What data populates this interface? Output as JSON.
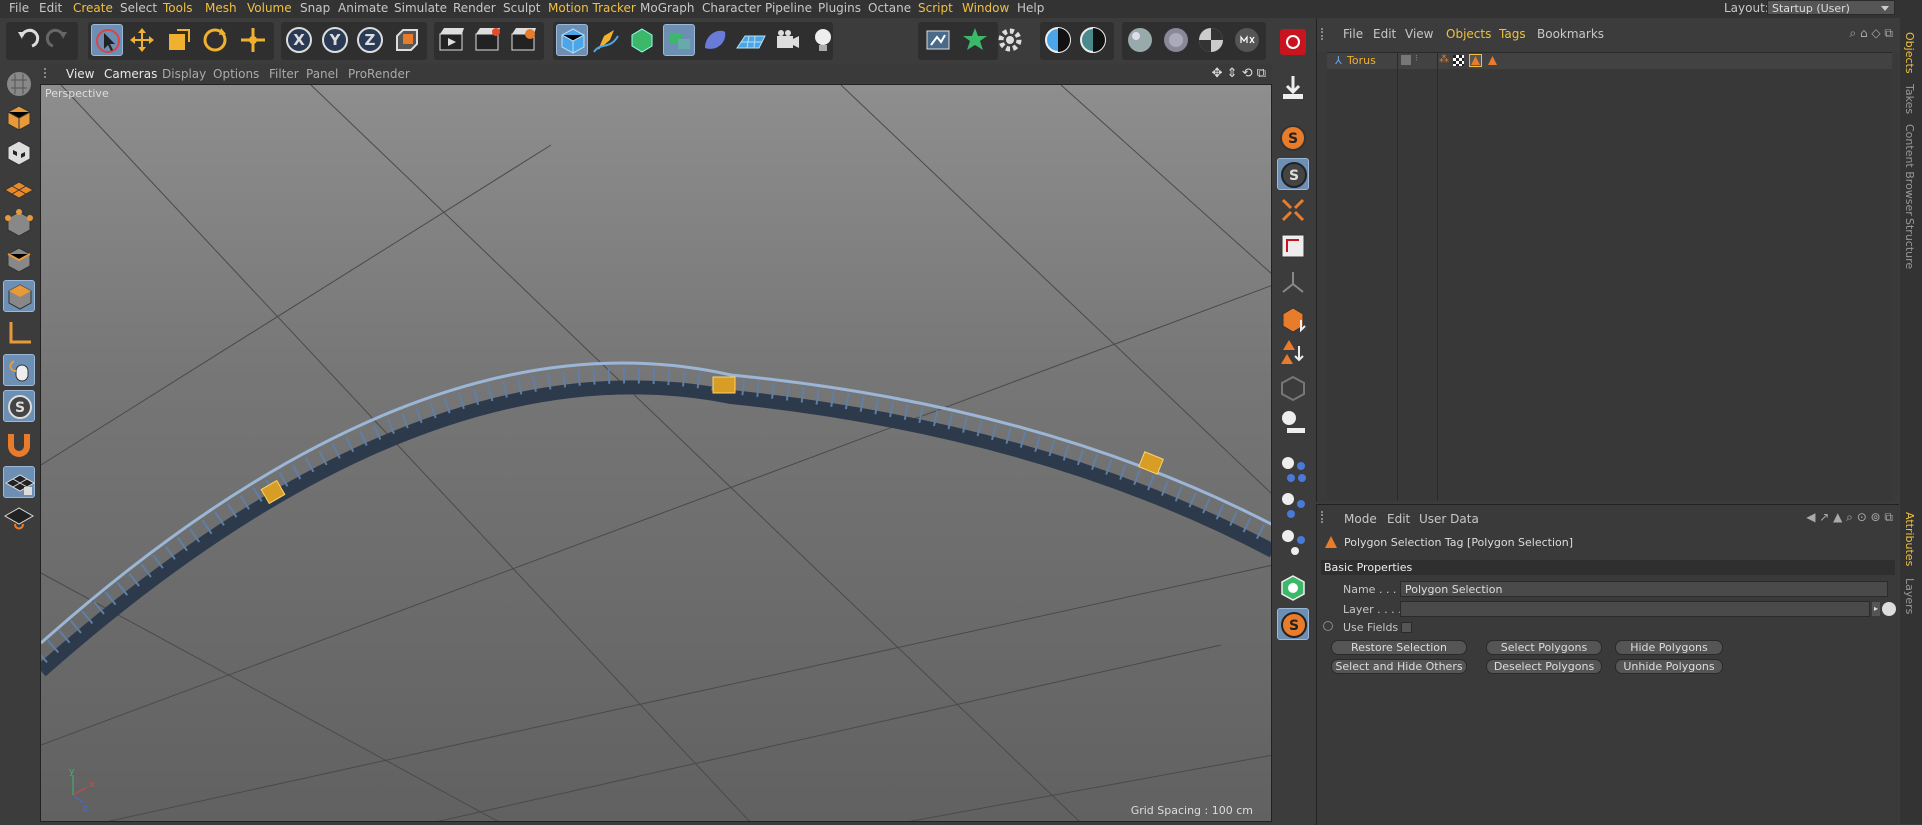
{
  "menu": [
    "File",
    "Edit",
    "Create",
    "Select",
    "Tools",
    "Mesh",
    "Volume",
    "Snap",
    "Animate",
    "Simulate",
    "Render",
    "Sculpt",
    "Motion Tracker",
    "MoGraph",
    "Character",
    "Pipeline",
    "Plugins",
    "Octane",
    "Script",
    "Window",
    "Help"
  ],
  "layout": {
    "label": "Layout:",
    "value": "Startup (User)"
  },
  "viewport": {
    "menu": [
      "View",
      "Cameras",
      "Display",
      "Options",
      "Filter",
      "Panel",
      "ProRender"
    ],
    "label": "Perspective",
    "grid_spacing": "Grid Spacing : 100 cm",
    "axis": {
      "x": "x",
      "y": "y",
      "z": "z"
    }
  },
  "toolbar_axis": {
    "x": "X",
    "y": "Y",
    "z": "Z"
  },
  "object_manager": {
    "menu": [
      "File",
      "Edit",
      "View",
      "Objects",
      "Tags",
      "Bookmarks"
    ],
    "objects": [
      {
        "name": "Torus"
      }
    ]
  },
  "attributes": {
    "menu": [
      "Mode",
      "Edit",
      "User Data"
    ],
    "title": "Polygon Selection Tag [Polygon Selection]",
    "section": "Basic Properties",
    "name_label": "Name . . .",
    "name_value": "Polygon Selection",
    "layer_label": "Layer . . . .",
    "use_fields": "Use Fields",
    "buttons": [
      "Restore Selection",
      "Select Polygons",
      "Hide Polygons",
      "Select and Hide Others",
      "Deselect Polygons",
      "Unhide Polygons"
    ]
  },
  "side_tabs": [
    "Objects",
    "Takes",
    "Content Browser",
    "Structure",
    "Attributes",
    "Layers"
  ],
  "colors": {
    "accent": "#f0c040",
    "selection": "#6d8fb3",
    "orange": "#e87c2a"
  }
}
